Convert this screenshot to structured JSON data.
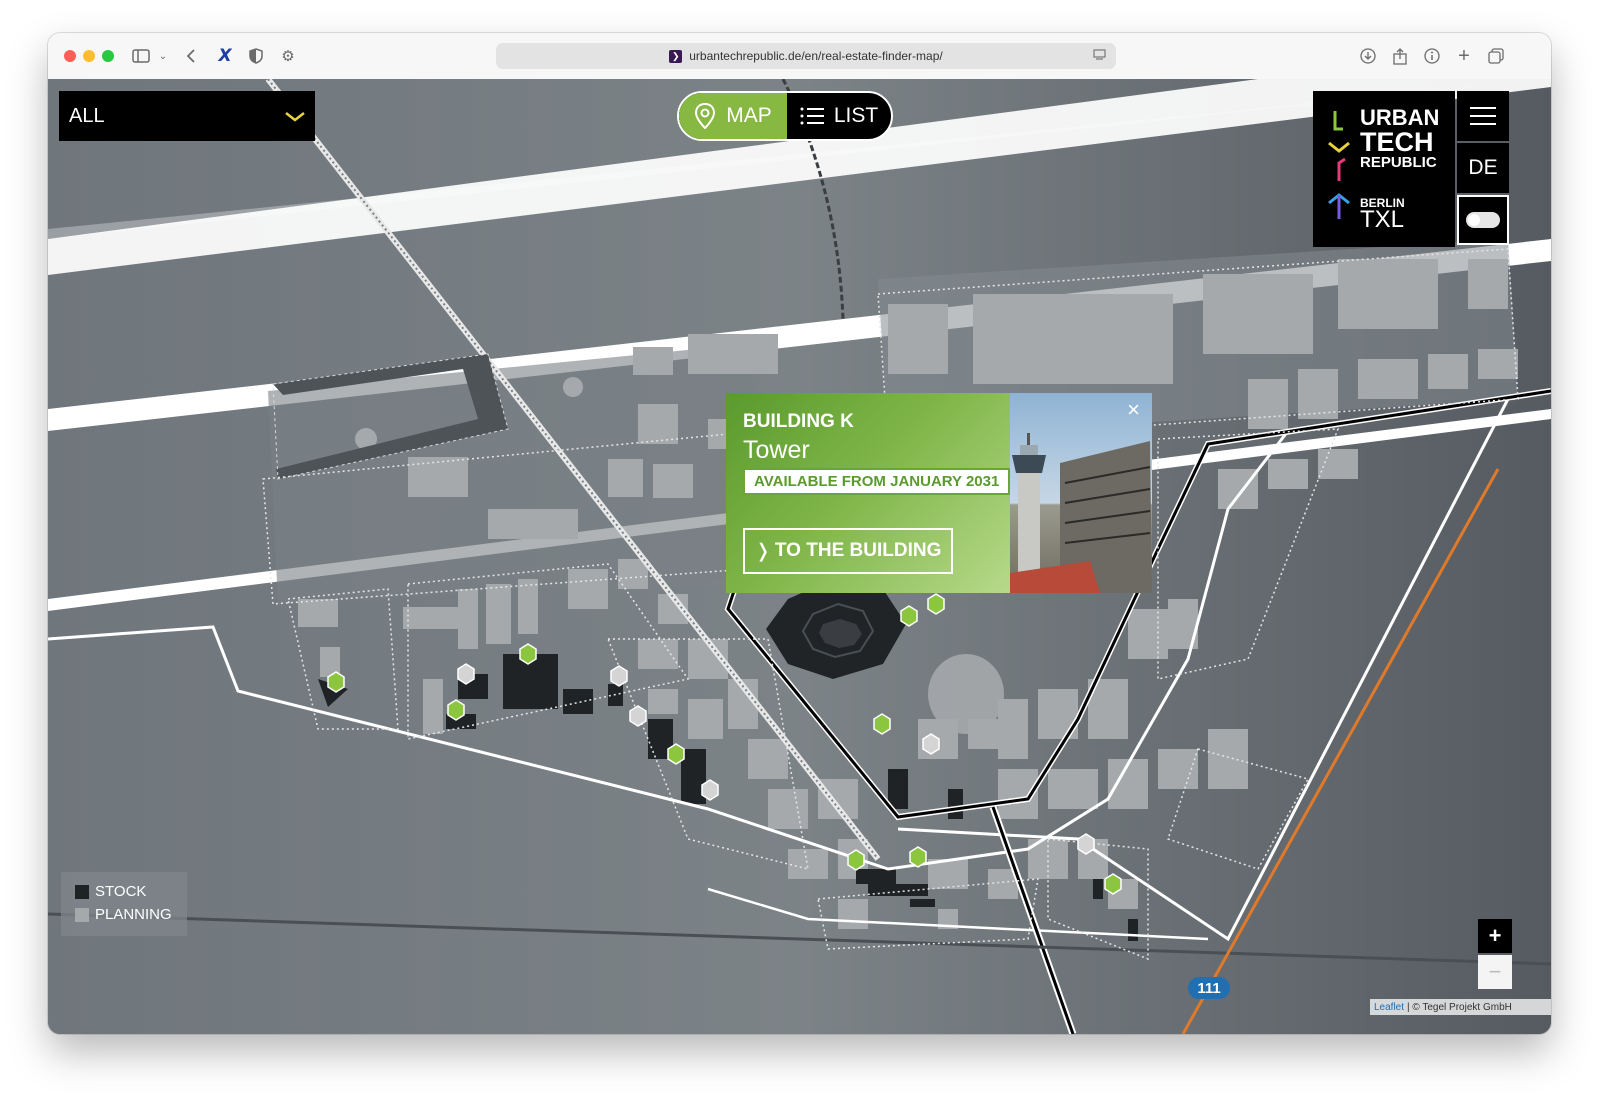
{
  "browser": {
    "url": "urbantechrepublic.de/en/real-estate-finder-map/",
    "favicon_glyph": "❯",
    "traffic_lights": [
      "#ff5f57",
      "#febc2e",
      "#28c840"
    ]
  },
  "filter": {
    "label": "ALL"
  },
  "view_toggle": {
    "map_label": "MAP",
    "list_label": "LIST",
    "active": "MAP"
  },
  "logo": {
    "line1": "URBAN",
    "line2": "TECH",
    "line3": "REPUBLIC",
    "line4": "BERLIN",
    "line5": "TXL"
  },
  "menu": {
    "language": "DE"
  },
  "popup": {
    "title": "BUILDING K",
    "subtitle": "Tower",
    "availability": "AVAILABLE FROM JANUARY 2031",
    "cta": "TO THE BUILDING",
    "close_glyph": "×"
  },
  "legend": {
    "stock": "STOCK",
    "planning": "PLANNING"
  },
  "zoom": {
    "in": "+",
    "out": "−"
  },
  "road_badge": "111",
  "attribution": {
    "link": "Leaflet",
    "text": "| © Tegel Projekt GmbH"
  },
  "colors": {
    "accent_green": "#86b842",
    "marker_green": "#8cc63f",
    "orange_line": "#e07a2a",
    "badge_blue": "#1f6fb2"
  }
}
